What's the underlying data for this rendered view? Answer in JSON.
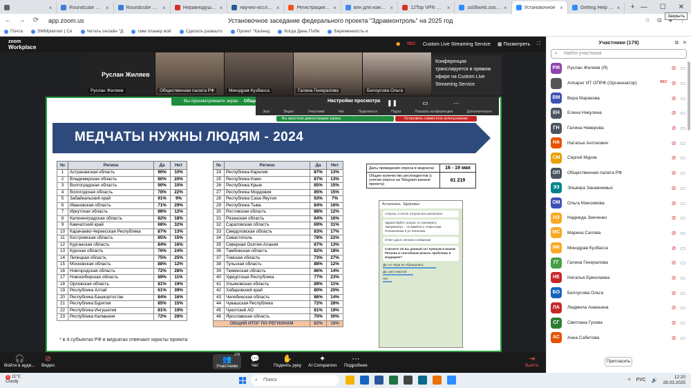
{
  "browser": {
    "tabs": [
      {
        "label": "",
        "color": "#5f6368"
      },
      {
        "label": "Roundcube Webm",
        "color": "#3b7dd8"
      },
      {
        "label": "Roundcube Webm",
        "color": "#3b7dd8"
      },
      {
        "label": "Неравнодушный",
        "color": "#d93025"
      },
      {
        "label": "научно-исследо",
        "color": "#2b5797"
      },
      {
        "label": "Регистрация в к",
        "color": "#f4511e"
      },
      {
        "label": "впн для компьюто",
        "color": "#4285f4"
      },
      {
        "label": "12Top VPN — скача",
        "color": "#d93025"
      },
      {
        "label": "us06web.zoom.us",
        "color": "#2d8cff"
      },
      {
        "label": "Установочное",
        "color": "#2d8cff",
        "active": true
      },
      {
        "label": "Getting Help from",
        "color": "#2d8cff"
      }
    ],
    "url": "app.zoom.us",
    "page_title": "Установочное заседание федерального проекта \"Здравконтроль\" на 2025 год",
    "bookmarks": [
      "Почта",
      "SMMplanner | Си",
      "Читать онлайн \"Д",
      "смм планер вой",
      "Сделать размыто",
      "Проект \"Календ",
      "Когда День Побе",
      "Беременность и"
    ]
  },
  "zoom_top": {
    "logo_line1": "zoom",
    "logo_line2": "Workplace",
    "rec": "REC",
    "stream": "Custom Live Streaming Service",
    "view": "Посмотреть"
  },
  "video_tiles": [
    {
      "name": "Руслан Жиляев",
      "big_name": "Руслан Жиляев"
    },
    {
      "name": "Общественная палата РФ",
      "big_name": ""
    },
    {
      "name": "Минздрав Кузбасса",
      "big_name": ""
    },
    {
      "name": "Галина Генералова",
      "big_name": ""
    },
    {
      "name": "Белоусова Ольга",
      "big_name": ""
    }
  ],
  "tooltip": "Конференция транслируется в прямом эфире на Custom Live Streaming Service",
  "share": {
    "viewing": "Вы просматриваете экран",
    "owner": "Общественная палата РФ",
    "settings_title": "Настройки просмотра",
    "controls": [
      "Звук",
      "Видео",
      "Участники",
      "Чат",
      "Поделиться",
      "Пауза",
      "Показать конференцию",
      "Дополнительно"
    ],
    "info": "Вы запустили демонстрацию экрана",
    "stop": "Остановить совместное использование"
  },
  "slide": {
    "title": "МЕДЧАТЫ НУЖНЫ ЛЮДЯМ - 2024",
    "headers": [
      "№",
      "Регион",
      "Да",
      "Нет"
    ],
    "left_rows": [
      [
        "1",
        "Астраханская область",
        "90%",
        "10%"
      ],
      [
        "2",
        "Владимирская область",
        "80%",
        "20%"
      ],
      [
        "3",
        "Волгоградская область",
        "90%",
        "10%"
      ],
      [
        "4",
        "Вологодская область",
        "78%",
        "22%"
      ],
      [
        "5",
        "Забайкальский край",
        "91%",
        "9%"
      ],
      [
        "6",
        "Ивановская область",
        "71%",
        "29%"
      ],
      [
        "7",
        "Иркутская область",
        "88%",
        "12%"
      ],
      [
        "8",
        "Калининградская область",
        "82%",
        "18%"
      ],
      [
        "9",
        "Камчатский край",
        "68%",
        "32%"
      ],
      [
        "10",
        "Карачаево-Черкесская Республика",
        "87%",
        "13%"
      ],
      [
        "11",
        "Костромская область",
        "85%",
        "15%"
      ],
      [
        "12",
        "Курганская область",
        "84%",
        "16%"
      ],
      [
        "13",
        "Курская область",
        "76%",
        "24%"
      ],
      [
        "14",
        "Липецкая область",
        "75%",
        "25%"
      ],
      [
        "15",
        "Московская область",
        "88%",
        "12%"
      ],
      [
        "16",
        "Новгородская область",
        "72%",
        "28%"
      ],
      [
        "17",
        "Новосибирская область",
        "89%",
        "11%"
      ],
      [
        "18",
        "Орловская область",
        "81%",
        "19%"
      ],
      [
        "19",
        "Республика Алтай",
        "61%",
        "39%"
      ],
      [
        "20",
        "Республика Башкортостан",
        "84%",
        "16%"
      ],
      [
        "21",
        "Республика Бурятия",
        "85%",
        "15%"
      ],
      [
        "22",
        "Республика Ингушетия",
        "81%",
        "19%"
      ],
      [
        "23",
        "Республика Калмыкия",
        "72%",
        "28%"
      ]
    ],
    "right_rows": [
      [
        "24",
        "Республика Карелия",
        "87%",
        "13%"
      ],
      [
        "25",
        "Республика Коми",
        "87%",
        "13%"
      ],
      [
        "26",
        "Республика Крым",
        "85%",
        "15%"
      ],
      [
        "27",
        "Республика Мордовия",
        "85%",
        "15%"
      ],
      [
        "28",
        "Республика Саха-Якутия",
        "93%",
        "7%"
      ],
      [
        "29",
        "Республика Тыва",
        "84%",
        "16%"
      ],
      [
        "30",
        "Ростовская область",
        "88%",
        "12%"
      ],
      [
        "31",
        "Рязанская область",
        "84%",
        "16%"
      ],
      [
        "32",
        "Саратовская область",
        "69%",
        "31%"
      ],
      [
        "33",
        "Свердловская область",
        "83%",
        "17%"
      ],
      [
        "34",
        "Севастополь",
        "78%",
        "22%"
      ],
      [
        "35",
        "Северная Осетия-Алания",
        "87%",
        "13%"
      ],
      [
        "36",
        "Тамбовская область",
        "82%",
        "18%"
      ],
      [
        "37",
        "Томская область",
        "73%",
        "27%"
      ],
      [
        "38",
        "Тульская область",
        "88%",
        "12%"
      ],
      [
        "39",
        "Тюменская область",
        "86%",
        "14%"
      ],
      [
        "40",
        "Удмуртская Республика",
        "77%",
        "23%"
      ],
      [
        "41",
        "Ульяновская область",
        "89%",
        "11%"
      ],
      [
        "42",
        "Хабаровский край",
        "80%",
        "20%"
      ],
      [
        "43",
        "Челябинская область",
        "86%",
        "14%"
      ],
      [
        "44",
        "Чувашская Республика",
        "72%",
        "28%"
      ],
      [
        "45",
        "Чукотский АО",
        "81%",
        "19%"
      ],
      [
        "46",
        "Ярославская область",
        "70%",
        "30%"
      ]
    ],
    "total": {
      "label": "ОБЩИЙ ИТОГ ПО РЕГИОНАМ",
      "yes": "82%",
      "no": "18%"
    },
    "survey": [
      {
        "label": "Даты проведения опроса в медчатах",
        "value": "16 - 19 мая"
      },
      {
        "label": "Общее количество респондентов (с учетом опроса на Telegram-канале проекта)",
        "value": "61 219"
      }
    ],
    "footnote": "* в 4 субъектах РФ в медчатах отвечают юристы проекта"
  },
  "chat_screenshot": {
    "header": "Астрахань. Здоровье",
    "messages": [
      "отпуска, а после отпуска все расписано",
      "Здравствуйте, вопрос по препарату Эмерминеус... оставайтесь открытыми Поликлиника 5 ул Латанова",
      "Ответ дан в личном сообщении",
      "Считаете ли вы данный чат нужным в вашем Регионе и способным решать проблемы в медицине?"
    ],
    "poll": [
      "Да, но чаще не обращались",
      "Да, уже помогли",
      "Нет"
    ]
  },
  "toolbar": {
    "audio": "Войти в ауди...",
    "video": "Видео",
    "participants": "Участники",
    "participants_count": "179",
    "chat": "Чат",
    "raise_hand": "Поднять руку",
    "ai": "AI Companion",
    "more": "Подробнее",
    "leave": "Выйти"
  },
  "panel": {
    "title": "Участники (179)",
    "search_placeholder": "Найти участника",
    "invite": "Пригласить",
    "close_tooltip": "Закрыть",
    "participants": [
      {
        "initials": "РЖ",
        "name": "Руслан Жиляев (Я)",
        "color": "#8e44ad"
      },
      {
        "initials": "",
        "name": "Аппарат ИТ ОПРФ (Организатор)",
        "color": "#555555",
        "rec": "REC"
      },
      {
        "initials": "ВМ",
        "name": "Вера Маракова",
        "color": "#3f51b5"
      },
      {
        "initials": "ЕН",
        "name": "Елена Никулина",
        "color": "#4b5563"
      },
      {
        "initials": "ГН",
        "name": "Галина Неверова",
        "color": "#4b5563"
      },
      {
        "initials": "НА",
        "name": "Наталья Антонович",
        "color": "#e65100"
      },
      {
        "initials": "СМ",
        "name": "Сергей Муров",
        "color": "#e6a100"
      },
      {
        "initials": "ОП",
        "name": "Общественная палата РФ",
        "color": "#4b5563"
      },
      {
        "initials": "ЭЗ",
        "name": "Эльвира Закамнемых",
        "color": "#00838f"
      },
      {
        "initials": "ОМ",
        "name": "Ольга Максимова",
        "color": "#3f51b5"
      },
      {
        "initials": "НЗ",
        "name": "Надежда Зинченко",
        "color": "#f9a825"
      },
      {
        "initials": "МС",
        "name": "Марина Салова",
        "color": "#f9a825"
      },
      {
        "initials": "МК",
        "name": "Минздрав Кузбасса",
        "color": "#f9a825"
      },
      {
        "initials": "ГГ",
        "name": "Галина Генералова",
        "color": "#43a047"
      },
      {
        "initials": "НЕ",
        "name": "Наталья Ермолаева",
        "color": "#c62828"
      },
      {
        "initials": "БО",
        "name": "Белоусова Ольга",
        "color": "#1565c0"
      },
      {
        "initials": "ЛА",
        "name": "Людмила Ананьина",
        "color": "#c62828"
      },
      {
        "initials": "СГ",
        "name": "Светлана Гусева",
        "color": "#2e7d32"
      },
      {
        "initials": "АС",
        "name": "Анна Сабитова",
        "color": "#e65100"
      }
    ]
  },
  "taskbar": {
    "temp": "11°C",
    "weather": "Cloudy",
    "alert_count": "1",
    "search": "Поиск",
    "lang": "РУС",
    "time": "12:20",
    "date": "28.03.2025"
  }
}
